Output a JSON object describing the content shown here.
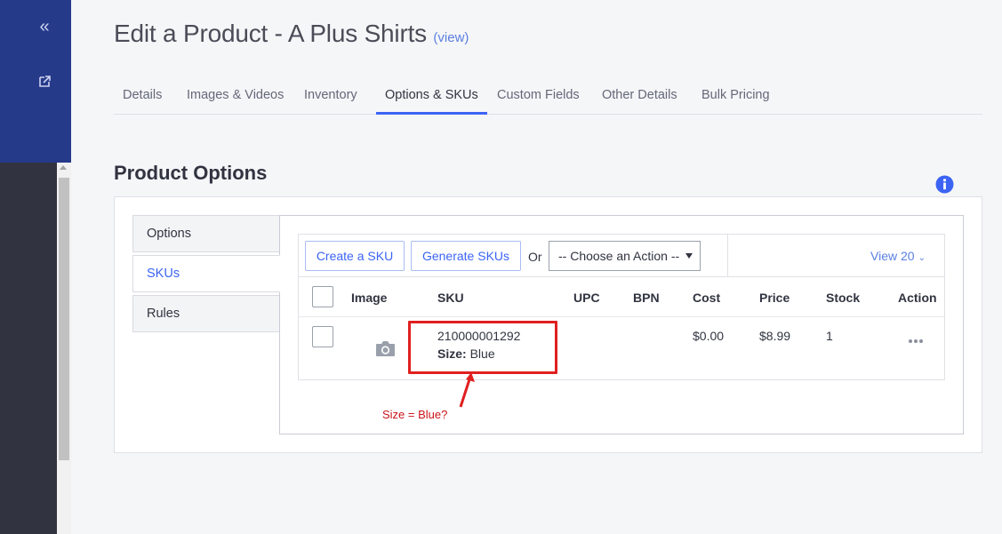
{
  "sidebar": {
    "collapse_icon": "double-chevron-left-icon",
    "external_icon": "external-link-icon"
  },
  "header": {
    "title": "Edit a Product - A Plus Shirts",
    "view_link": "(view)"
  },
  "tabs": [
    {
      "label": "Details",
      "active": false
    },
    {
      "label": "Images & Videos",
      "active": false
    },
    {
      "label": "Inventory",
      "active": false
    },
    {
      "label": "Options & SKUs",
      "active": true
    },
    {
      "label": "Custom Fields",
      "active": false
    },
    {
      "label": "Other Details",
      "active": false
    },
    {
      "label": "Bulk Pricing",
      "active": false
    }
  ],
  "section": {
    "title": "Product Options",
    "info_icon": "info-icon"
  },
  "side_tabs": [
    {
      "label": "Options",
      "active": false
    },
    {
      "label": "SKUs",
      "active": true
    },
    {
      "label": "Rules",
      "active": false
    }
  ],
  "toolbar": {
    "create_sku": "Create a SKU",
    "generate_skus": "Generate SKUs",
    "or": "Or",
    "action_select": "-- Choose an Action --",
    "view_count": "View 20"
  },
  "table": {
    "columns": [
      "Image",
      "SKU",
      "UPC",
      "BPN",
      "Cost",
      "Price",
      "Stock",
      "Action"
    ],
    "rows": [
      {
        "sku": "210000001292",
        "option_label": "Size:",
        "option_value": "Blue",
        "upc": "",
        "bpn": "",
        "cost": "$0.00",
        "price": "$8.99",
        "stock": "1"
      }
    ]
  },
  "annotation": {
    "text": "Size = Blue?",
    "color": "#e02020"
  },
  "colors": {
    "sidebar": "#263a8a",
    "accent": "#3c64f4",
    "link": "#5a7fe0"
  }
}
